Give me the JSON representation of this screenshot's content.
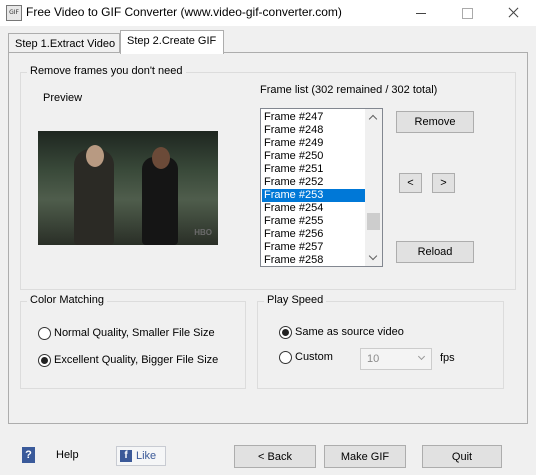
{
  "window": {
    "title": "Free Video to GIF Converter (www.video-gif-converter.com)",
    "icon_text": "GIF"
  },
  "tabs": [
    {
      "label": "Step 1.Extract Video",
      "active": false
    },
    {
      "label": "Step 2.Create GIF",
      "active": true
    }
  ],
  "frames_group": {
    "legend": "Remove frames you don't need",
    "preview_label": "Preview",
    "watermark": "HBO",
    "frame_list_label": "Frame list (302 remained / 302 total)",
    "frames": [
      "Frame #247",
      "Frame #248",
      "Frame #249",
      "Frame #250",
      "Frame #251",
      "Frame #252",
      "Frame #253",
      "Frame #254",
      "Frame #255",
      "Frame #256",
      "Frame #257",
      "Frame #258"
    ],
    "selected_frame": "Frame #253",
    "remove_label": "Remove",
    "prev_label": "<",
    "next_label": ">",
    "reload_label": "Reload"
  },
  "color_matching": {
    "legend": "Color Matching",
    "options": [
      "Normal Quality, Smaller File Size",
      "Excellent Quality, Bigger File Size"
    ],
    "selected": "Excellent Quality, Bigger File Size"
  },
  "play_speed": {
    "legend": "Play Speed",
    "options": [
      "Same as source video",
      "Custom"
    ],
    "selected": "Same as source video",
    "custom_value": "10",
    "unit": "fps"
  },
  "footer": {
    "help_label": "Help",
    "like_label": "Like",
    "like_icon": "f",
    "back_label": "< Back",
    "make_gif_label": "Make GIF",
    "quit_label": "Quit"
  }
}
